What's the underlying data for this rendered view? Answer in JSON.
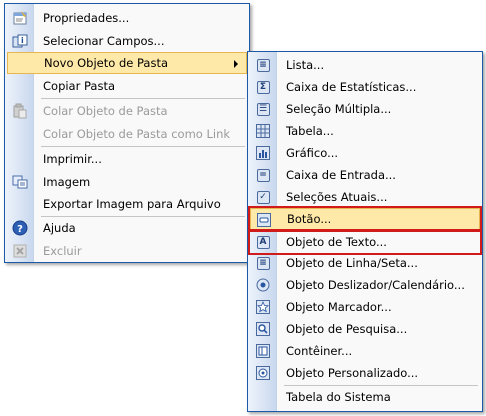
{
  "main_menu": {
    "items": [
      {
        "label": "Propriedades...",
        "icon": "properties-icon"
      },
      {
        "label": "Selecionar Campos...",
        "icon": "select-fields-icon"
      },
      {
        "label": "Novo Objeto de Pasta",
        "icon": "",
        "has_submenu": true,
        "highlighted": true
      },
      {
        "label": "Copiar Pasta",
        "icon": ""
      },
      {
        "label": "Colar Objeto de Pasta",
        "icon": "paste-icon",
        "disabled": true
      },
      {
        "label": "Colar Objeto de Pasta como Link",
        "icon": "",
        "disabled": true
      },
      {
        "label": "Imprimir...",
        "icon": ""
      },
      {
        "label": "Imagem",
        "icon": "image-icon"
      },
      {
        "label": "Exportar Imagem para Arquivo",
        "icon": ""
      },
      {
        "label": "Ajuda",
        "icon": "help-icon"
      },
      {
        "label": "Excluir",
        "icon": "delete-icon",
        "disabled": true
      }
    ]
  },
  "sub_menu": {
    "items": [
      {
        "label": "Lista...",
        "icon": "list-icon"
      },
      {
        "label": "Caixa de Estatísticas...",
        "icon": "statistics-icon"
      },
      {
        "label": "Seleção Múltipla...",
        "icon": "multi-select-icon"
      },
      {
        "label": "Tabela...",
        "icon": "table-icon"
      },
      {
        "label": "Gráfico...",
        "icon": "chart-icon"
      },
      {
        "label": "Caixa de Entrada...",
        "icon": "input-box-icon"
      },
      {
        "label": "Seleções Atuais...",
        "icon": "current-selections-icon"
      },
      {
        "label": "Botão...",
        "icon": "button-icon",
        "highlighted": true,
        "boxed": true
      },
      {
        "label": "Objeto de Texto...",
        "icon": "text-object-icon",
        "boxed": true
      },
      {
        "label": "Objeto de Linha/Seta...",
        "icon": "line-arrow-icon"
      },
      {
        "label": "Objeto Deslizador/Calendário...",
        "icon": "slider-icon"
      },
      {
        "label": "Objeto Marcador...",
        "icon": "bookmark-icon"
      },
      {
        "label": "Objeto de Pesquisa...",
        "icon": "search-icon"
      },
      {
        "label": "Contêiner...",
        "icon": "container-icon"
      },
      {
        "label": "Objeto Personalizado...",
        "icon": "custom-object-icon"
      },
      {
        "label": "Tabela do Sistema",
        "icon": ""
      }
    ]
  },
  "colors": {
    "highlight_bg": "#ffe9a8",
    "highlight_border": "#e8b650",
    "annotation_box": "#d11a1a",
    "menu_border": "#1c5aa8"
  }
}
